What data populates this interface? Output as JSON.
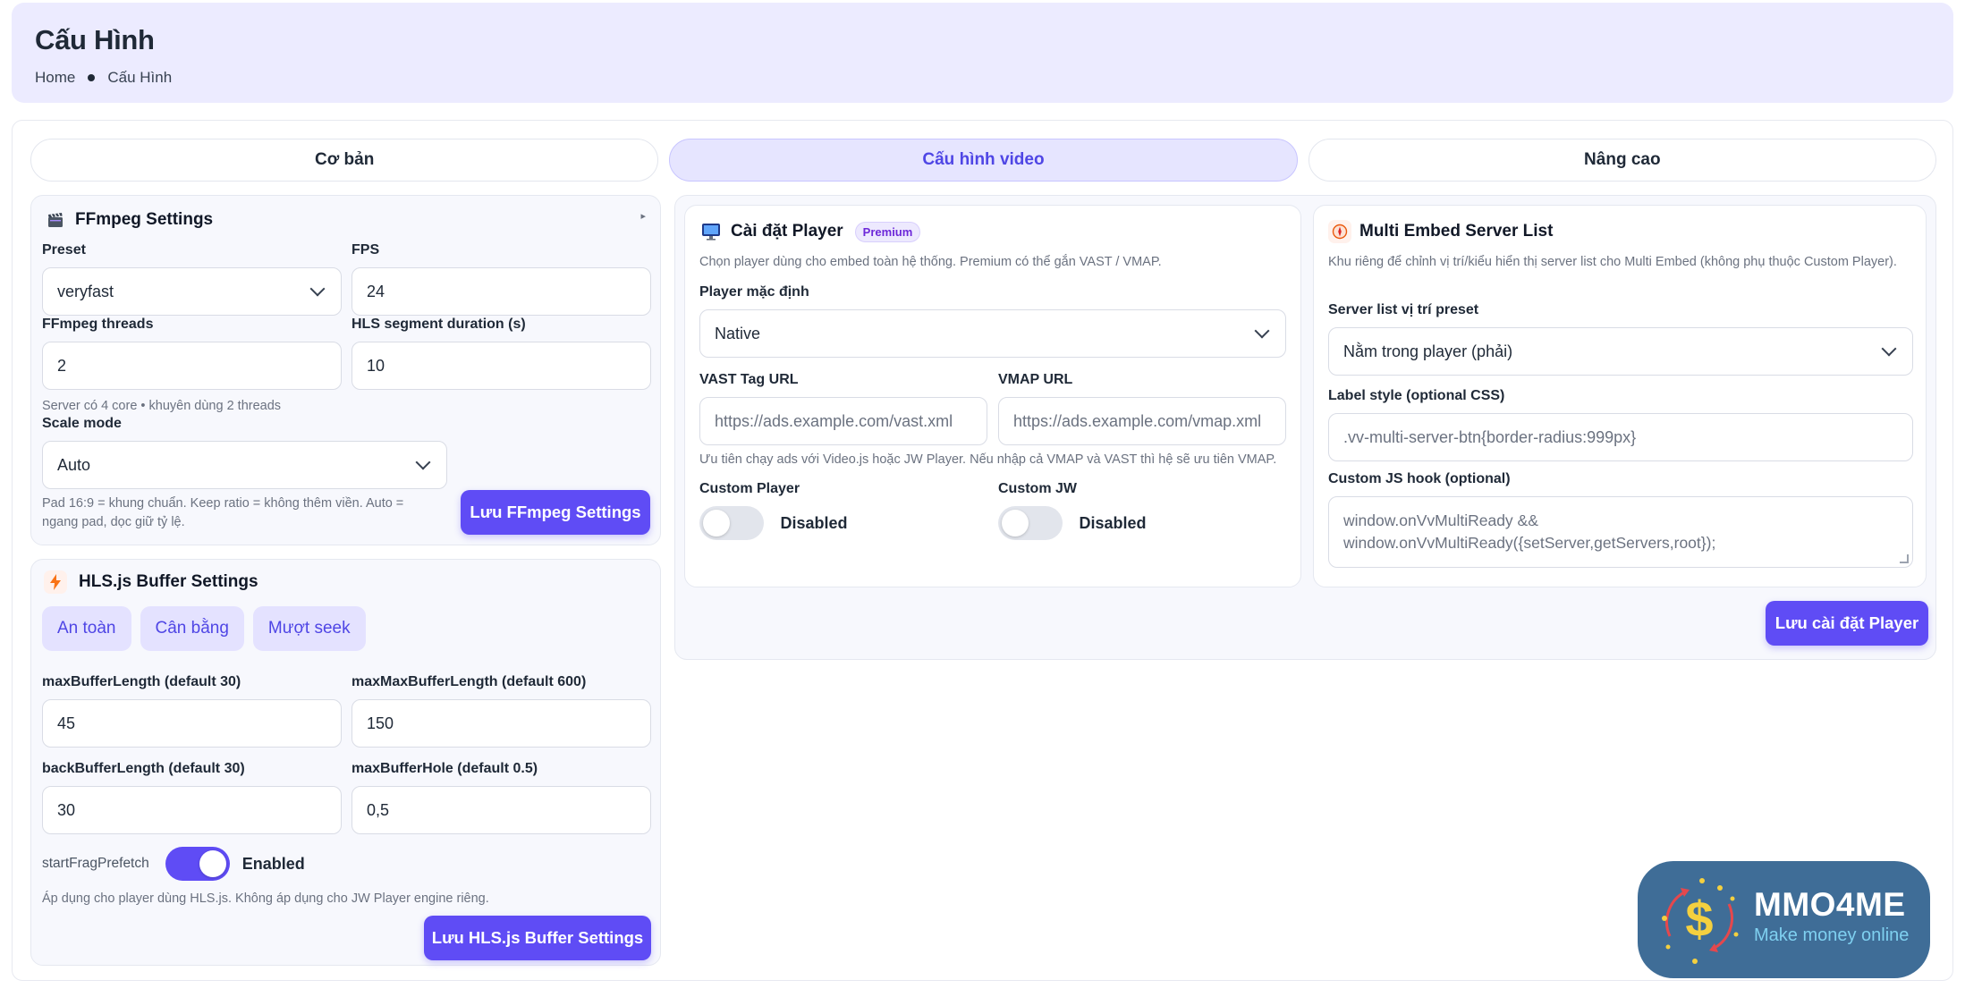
{
  "header": {
    "title": "Cấu Hình",
    "breadcrumb": [
      "Home",
      "Cấu Hình"
    ]
  },
  "tabs": [
    {
      "label": "Cơ bản",
      "active": false
    },
    {
      "label": "Cấu hình video",
      "active": true
    },
    {
      "label": "Nâng cao",
      "active": false
    }
  ],
  "ffmpeg": {
    "title": "FFmpeg Settings",
    "icon": "clapperboard-icon",
    "collapse_glyph": "▸",
    "preset_label": "Preset",
    "preset_value": "veryfast",
    "fps_label": "FPS",
    "fps_value": "24",
    "threads_label": "FFmpeg threads",
    "threads_value": "2",
    "hls_label": "HLS segment duration (s)",
    "hls_value": "10",
    "threads_hint": "Server có 4 core • khuyên dùng 2 threads",
    "scale_label": "Scale mode",
    "scale_value": "Auto",
    "scale_hint": "Pad 16:9 = khung chuẩn. Keep ratio = không thêm viền. Auto = ngang pad, dọc giữ tỷ lệ.",
    "save_label": "Lưu FFmpeg Settings"
  },
  "hls": {
    "title": "HLS.js Buffer Settings",
    "icon": "lightning-icon",
    "presets": [
      "An toàn",
      "Cân bằng",
      "Mượt seek"
    ],
    "max_buffer_label": "maxBufferLength (default 30)",
    "max_buffer_value": "45",
    "max_max_label": "maxMaxBufferLength (default 600)",
    "max_max_value": "150",
    "back_label": "backBufferLength (default 30)",
    "back_value": "30",
    "hole_label": "maxBufferHole (default 0.5)",
    "hole_value": "0,5",
    "prefetch_label": "startFragPrefetch",
    "prefetch_state": "Enabled",
    "prefetch_on": true,
    "hint": "Áp dụng cho player dùng HLS.js. Không áp dụng cho JW Player engine riêng.",
    "save_label": "Lưu HLS.js Buffer Settings"
  },
  "player": {
    "title": "Cài đặt Player",
    "badge": "Premium",
    "icon": "monitor-icon",
    "desc": "Chọn player dùng cho embed toàn hệ thống. Premium có thể gắn VAST / VMAP.",
    "default_label": "Player mặc định",
    "default_value": "Native",
    "vast_label": "VAST Tag URL",
    "vast_placeholder": "https://ads.example.com/vast.xml",
    "vmap_label": "VMAP URL",
    "vmap_placeholder": "https://ads.example.com/vmap.xml",
    "ads_hint": "Ưu tiên chạy ads với Video.js hoặc JW Player. Nếu nhập cả VMAP và VAST thì hệ sẽ ưu tiên VMAP.",
    "custom_player_label": "Custom Player",
    "custom_player_state": "Disabled",
    "custom_jw_label": "Custom JW",
    "custom_jw_state": "Disabled",
    "save_label": "Lưu cài đặt Player"
  },
  "multi": {
    "title": "Multi Embed Server List",
    "icon": "compass-icon",
    "desc": "Khu riêng để chỉnh vị trí/kiểu hiển thị server list cho Multi Embed (không phụ thuộc Custom Player).",
    "position_label": "Server list vị trí preset",
    "position_value": "Nằm trong player (phải)",
    "style_label": "Label style (optional CSS)",
    "style_placeholder": ".vv-multi-server-btn{border-radius:999px}",
    "hook_label": "Custom JS hook (optional)",
    "hook_placeholder": "window.onVvMultiReady && window.onVvMultiReady({setServer,getServers,root});"
  },
  "logo": {
    "name": "MMO4ME",
    "tagline": "Make money online"
  },
  "colors": {
    "accent": "#5f4cf5",
    "header_bg": "#ecebff",
    "logo_bg": "#3f6d97"
  }
}
